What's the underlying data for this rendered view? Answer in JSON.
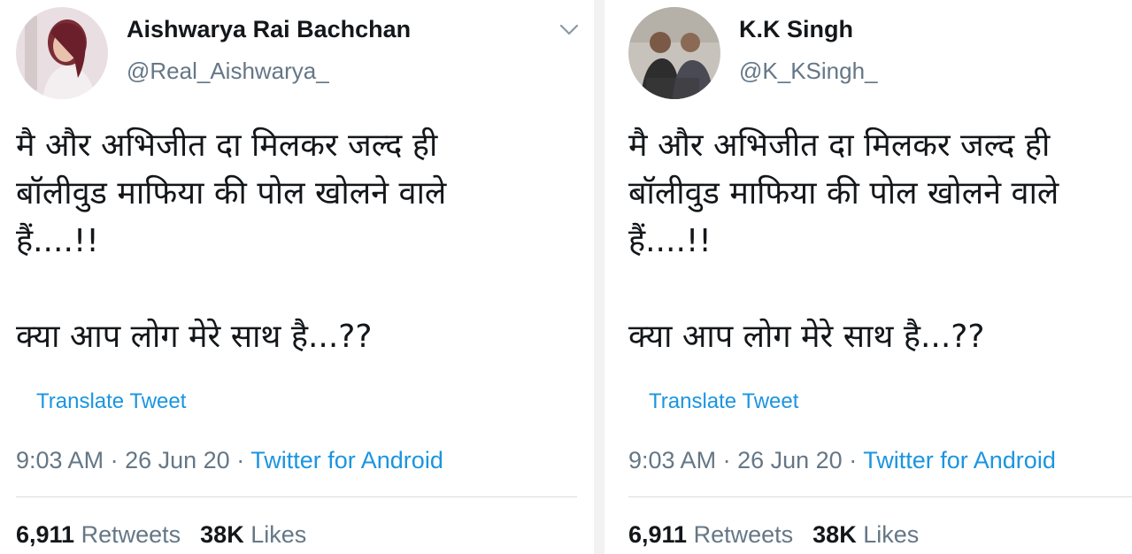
{
  "tweets": [
    {
      "name": "Aishwarya Rai Bachchan",
      "handle": "@Real_Aishwarya_",
      "text": "मै और अभिजीत दा मिलकर जल्द ही\nबॉलीवुड माफिया की पोल खोलने वाले\nहैं....!!\n\nक्या आप लोग मेरे साथ है...??",
      "translate_label": "Translate Tweet",
      "time": "9:03 AM",
      "date": "26 Jun 20",
      "source": "Twitter for Android",
      "retweets_count": "6,911",
      "retweets_label": "Retweets",
      "likes_count": "38K",
      "likes_label": "Likes"
    },
    {
      "name": "K.K Singh",
      "handle": "@K_KSingh_",
      "text": "मै और अभिजीत दा मिलकर जल्द ही\nबॉलीवुड माफिया की पोल खोलने वाले\nहैं....!!\n\nक्या आप लोग मेरे साथ है...??",
      "translate_label": "Translate Tweet",
      "time": "9:03 AM",
      "date": "26 Jun 20",
      "source": "Twitter for Android",
      "retweets_count": "6,911",
      "retweets_label": "Retweets",
      "likes_count": "38K",
      "likes_label": "Likes"
    }
  ],
  "meta_separator": "·",
  "icons": {
    "menu": "chevron-down-icon"
  },
  "colors": {
    "link": "#1b95e0",
    "muted": "#657786",
    "text": "#14171a"
  }
}
